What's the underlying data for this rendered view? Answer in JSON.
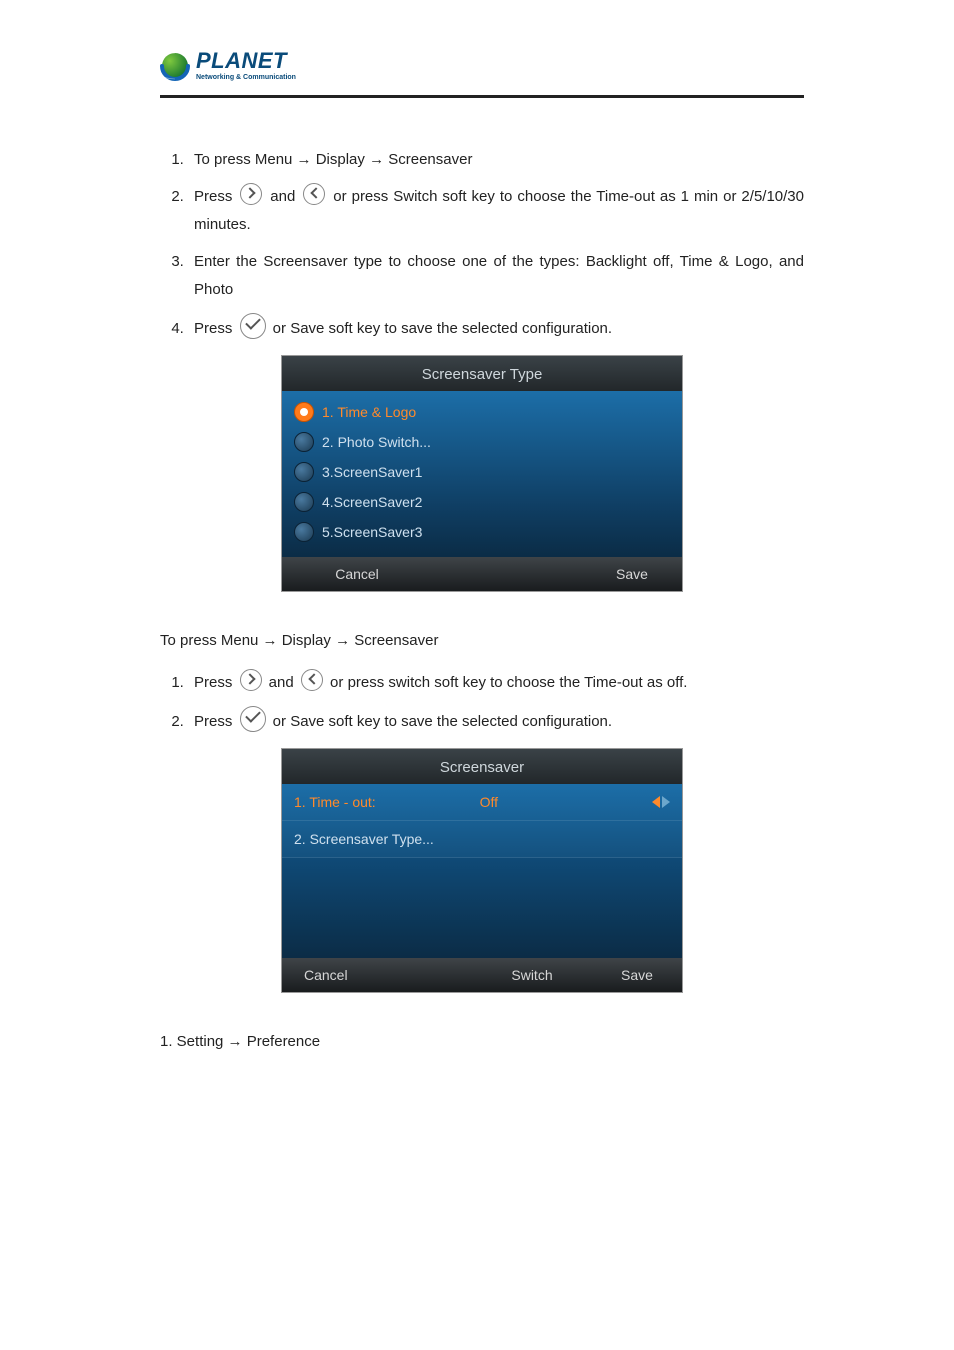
{
  "logo": {
    "brand": "PLANET",
    "tagline": "Networking & Communication"
  },
  "section1": {
    "steps": [
      "To press Menu → Display → Screensaver",
      "Press __RIGHT__ and __LEFT__ or press Switch soft key to choose the Time-out as 1 min or 2/5/10/30 minutes.",
      "Enter the Screensaver type to choose one of the types: Backlight off, Time & Logo, and Photo",
      "Press __CHECK__ or Save soft key to save the selected configuration."
    ]
  },
  "screenshot1": {
    "title": "Screensaver Type",
    "options": [
      {
        "label": "1. Time & Logo",
        "selected": true
      },
      {
        "label": "2. Photo Switch...",
        "selected": false
      },
      {
        "label": "3.ScreenSaver1",
        "selected": false
      },
      {
        "label": "4.ScreenSaver2",
        "selected": false
      },
      {
        "label": "5.ScreenSaver3",
        "selected": false
      }
    ],
    "softkeys": {
      "left": "Cancel",
      "right": "Save"
    }
  },
  "section2": {
    "intro": "To press Menu → Display → Screensaver",
    "steps": [
      "Press __RIGHT__ and __LEFT__ or press switch soft key to choose the Time-out as off.",
      "Press __CHECK__ or Save soft key to save the selected configuration."
    ]
  },
  "screenshot2": {
    "title": "Screensaver",
    "row1": {
      "label": "1. Time - out:",
      "value": "Off"
    },
    "row2": {
      "label": "2. Screensaver Type..."
    },
    "softkeys": {
      "left": "Cancel",
      "mid": "Switch",
      "right": "Save"
    }
  },
  "bottom": "1. Setting → Preference"
}
